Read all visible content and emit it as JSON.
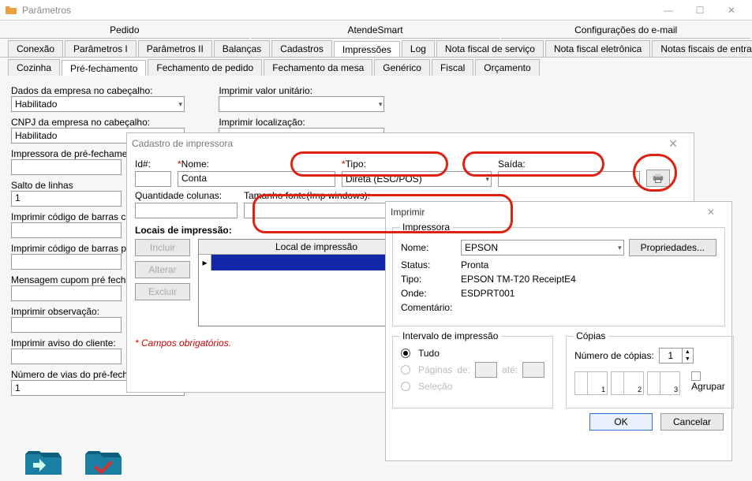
{
  "main": {
    "title": "Parâmetros",
    "toptabs": [
      "Pedido",
      "AtendeSmart",
      "Configurações do e-mail"
    ],
    "tabs2": [
      "Conexão",
      "Parâmetros I",
      "Parâmetros II",
      "Balanças",
      "Cadastros",
      "Impressões",
      "Log",
      "Nota fiscal de serviço",
      "Nota fiscal eletrônica",
      "Notas fiscais de entrada"
    ],
    "tabs2_selected": "Impressões",
    "tabs3": [
      "Cozinha",
      "Pré-fechamento",
      "Fechamento de pedido",
      "Fechamento da mesa",
      "Genérico",
      "Fiscal",
      "Orçamento"
    ],
    "tabs3_selected": "Pré-fechamento",
    "labels": {
      "dados_cab": "Dados da empresa no cabeçalho:",
      "dados_cab_val": "Habilitado",
      "cnpj_cab": "CNPJ da empresa no cabeçalho:",
      "cnpj_cab_val": "Habilitado",
      "imp_pre": "Impressora de pré-fechamen",
      "salto": "Salto de linhas",
      "salto_val": "1",
      "imp_cod_cu": "Imprimir código de barras cu",
      "imp_cod_pr": "Imprimir código de barras prd",
      "msg_cupom": "Mensagem cupom pré fechar",
      "imp_obs": "Imprimir observação:",
      "imp_aviso": "Imprimir aviso do cliente:",
      "num_vias": "Número de vias do pré-fechamento:",
      "num_vias_val": "1",
      "imp_valor": "Imprimir valor unitário:",
      "imp_loc": "Imprimir localização:"
    }
  },
  "cad": {
    "title": "Cadastro de impressora",
    "labels": {
      "id": "Id#:",
      "nome": "Nome:",
      "tipo": "Tipo:",
      "saida": "Saída:",
      "qtd_col": "Quantidade colunas:",
      "tam_fonte": "Tamanho fonte(Imp windows):"
    },
    "values": {
      "nome": "Conta",
      "tipo": "Direta (ESC/POS)"
    },
    "section": "Locais de impressão:",
    "grid_header": "Local de impressão",
    "btns": {
      "incluir": "Incluir",
      "alterar": "Alterar",
      "excluir": "Excluir"
    },
    "obrig": "Campos obrigatórios."
  },
  "print": {
    "title": "Imprimir",
    "group1": "Impressora",
    "nome": "Nome:",
    "nome_val": "EPSON",
    "props": "Propriedades...",
    "status": "Status:",
    "status_val": "Pronta",
    "tipo": "Tipo:",
    "tipo_val": "EPSON TM-T20 ReceiptE4",
    "onde": "Onde:",
    "onde_val": "ESDPRT001",
    "coment": "Comentário:",
    "group2": "Intervalo de impressão",
    "tudo": "Tudo",
    "paginas": "Páginas",
    "de": "de:",
    "ate": "até:",
    "selecao": "Seleção",
    "group3": "Cópias",
    "numcop": "Número de cópias:",
    "numcop_val": "1",
    "agrupar": "Agrupar",
    "ok": "OK",
    "cancel": "Cancelar"
  }
}
